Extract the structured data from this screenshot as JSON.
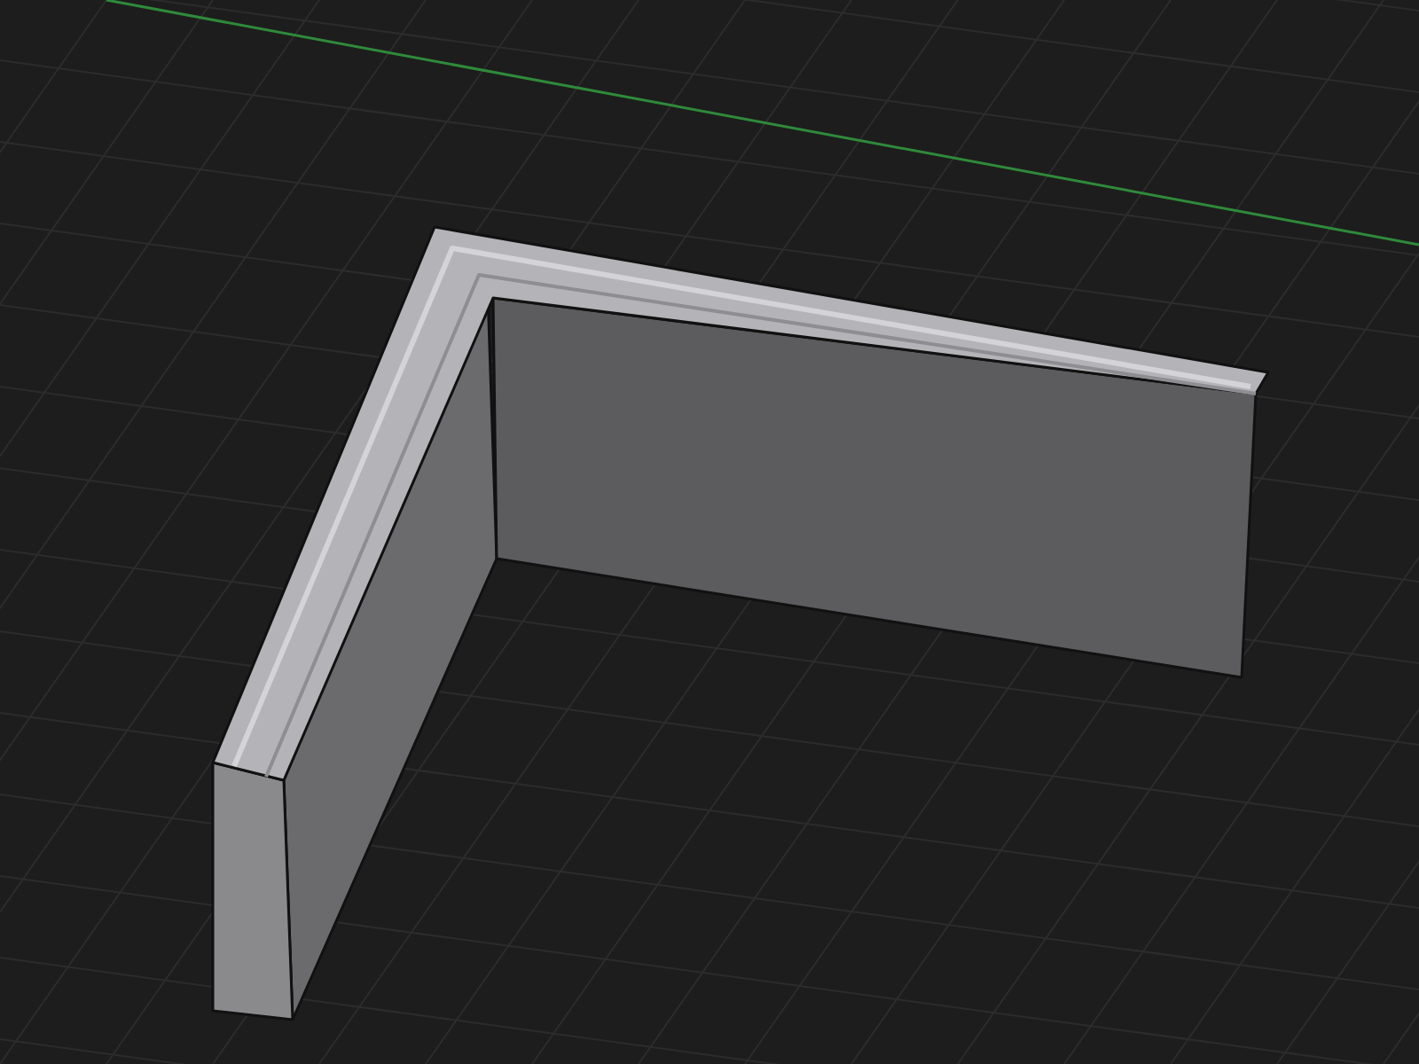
{
  "viewport": {
    "grid": true,
    "axis": true
  }
}
